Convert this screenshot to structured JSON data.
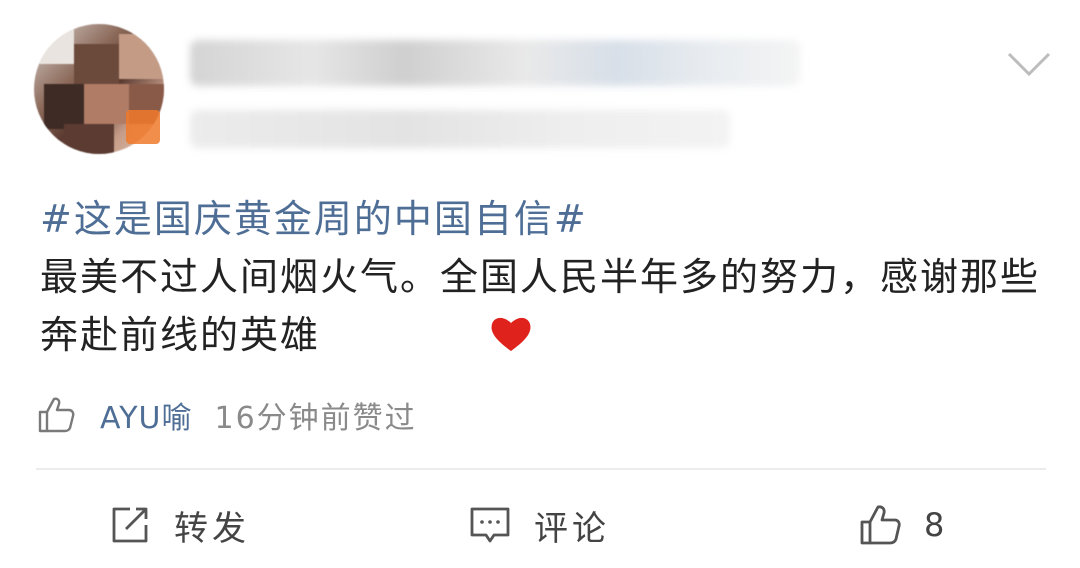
{
  "post": {
    "topic": "#这是国庆黄金周的中国自信#",
    "text": "最美不过人间烟火气。全国人民半年多的努力，感谢那些奔赴前线的英雄"
  },
  "like_info": {
    "user": "AYU喻",
    "time": "16分钟前赞过"
  },
  "actions": {
    "repost_label": "转发",
    "comment_label": "评论",
    "like_count": "8"
  },
  "icons": {
    "menu": "chevron-down-icon",
    "heart": "red-heart-emoji",
    "thumbs_up": "thumbs-up-icon",
    "repost": "share-icon",
    "comment": "comment-icon"
  },
  "colors": {
    "link": "#4e6e96",
    "text": "#222222",
    "muted": "#8a8a8a",
    "heart": "#e0221d"
  }
}
